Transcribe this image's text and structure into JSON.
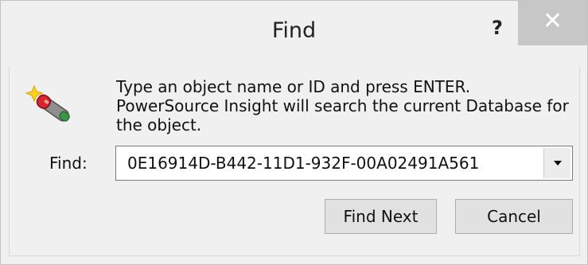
{
  "window": {
    "title": "Find",
    "help_label": "?",
    "close_label": "✕"
  },
  "dialog": {
    "icon": "magic-wand-icon",
    "instructions_line1": "Type an object name or ID and press ENTER.",
    "instructions_line2": "PowerSource Insight will search the current Database for",
    "instructions_line3": "the object.",
    "find_label": "Find:",
    "find_value": "0E16914D-B442-11D1-932F-00A02491A561",
    "dropdown_icon": "chevron-down-icon"
  },
  "buttons": {
    "find_next": "Find Next",
    "cancel": "Cancel"
  }
}
